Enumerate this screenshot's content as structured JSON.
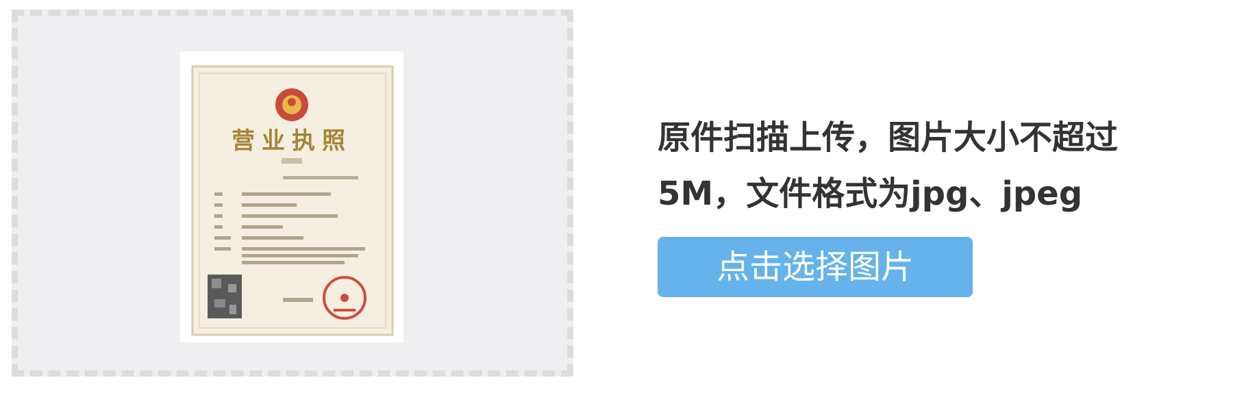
{
  "upload": {
    "sample_image": {
      "icon": "business-license-sample-image",
      "title": "营业执照"
    }
  },
  "instructions": {
    "line1": "原件扫描上传，图片大小不超过",
    "line2": "5M，文件格式为jpg、jpeg"
  },
  "choose_button": {
    "label": "点击选择图片",
    "color": "#65b3ea"
  },
  "colors": {
    "frame_background": "#efeff1",
    "frame_border": "#dcdcdc",
    "text": "#333333"
  }
}
